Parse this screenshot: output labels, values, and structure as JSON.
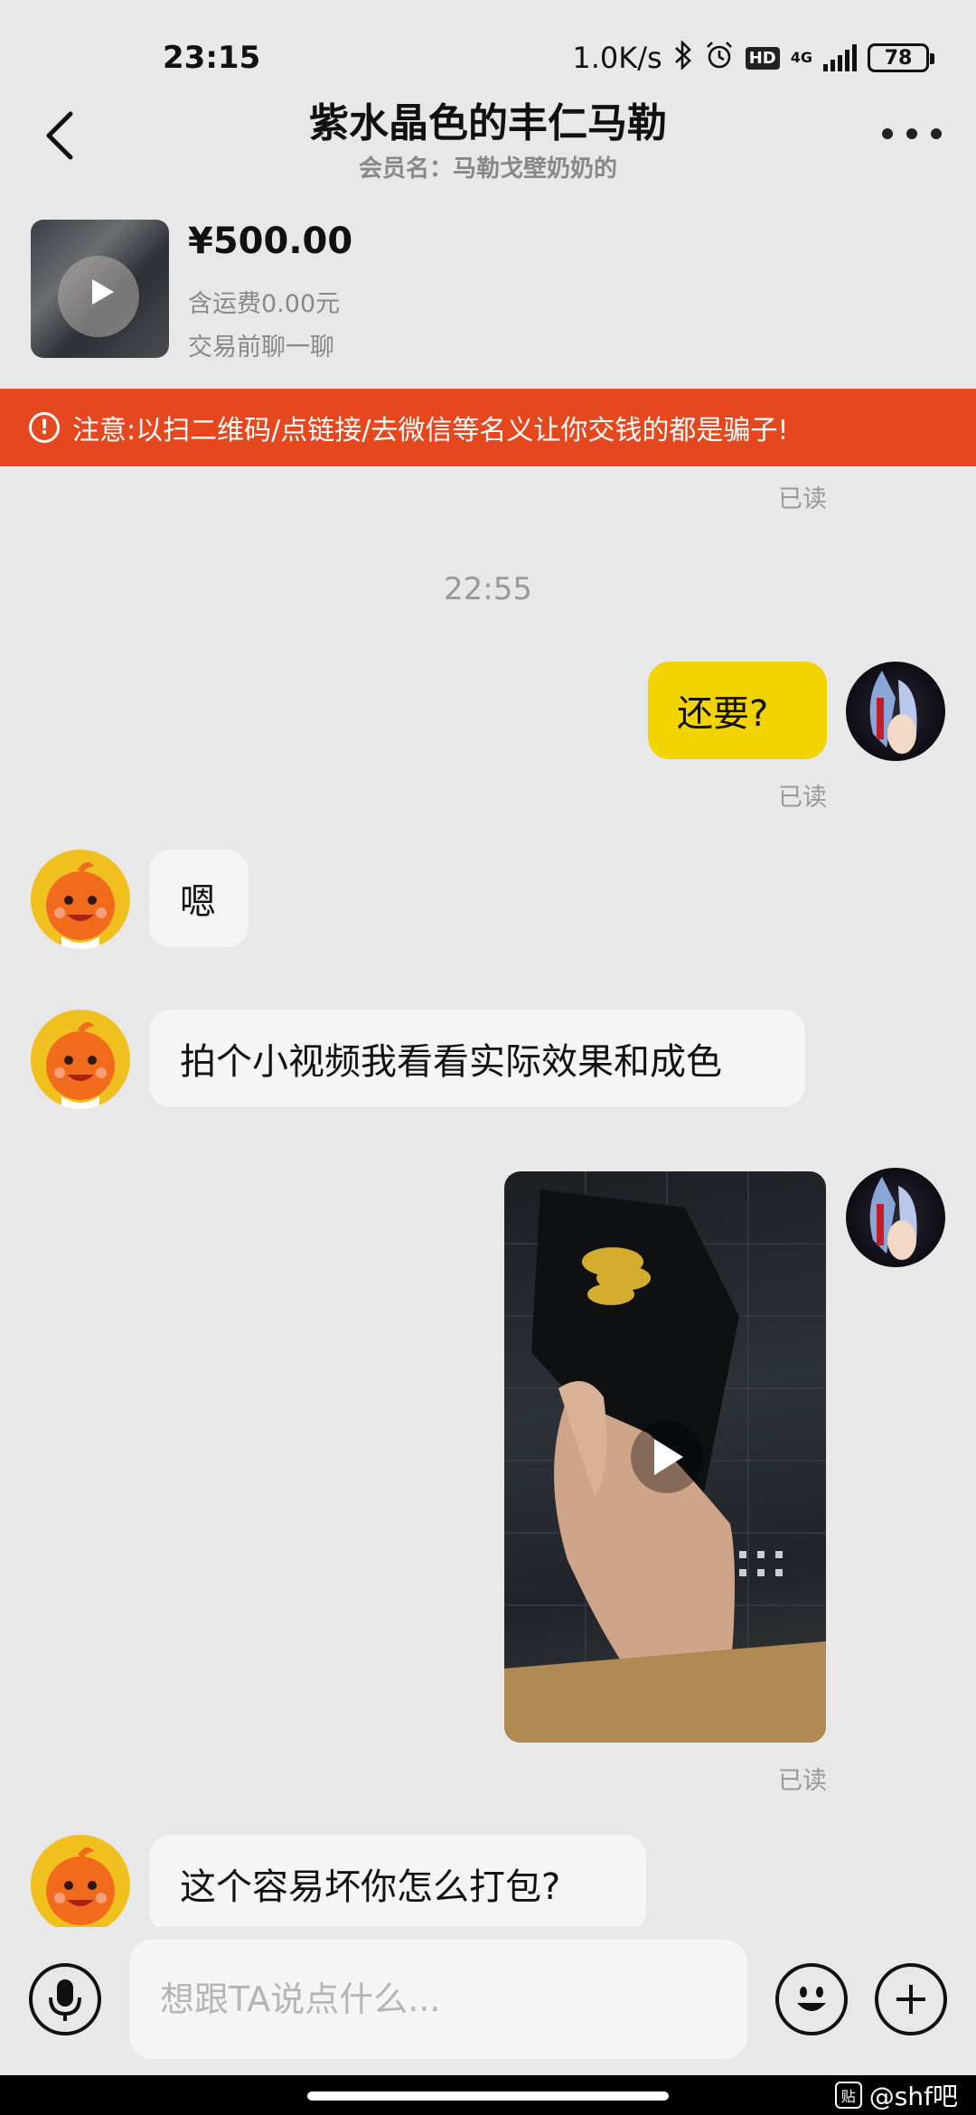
{
  "status_bar": {
    "time": "23:15",
    "net_speed": "1.0K/s",
    "hd": "HD",
    "network": "4G",
    "battery": "78"
  },
  "header": {
    "title": "紫水晶色的丰仁马勒",
    "subtitle": "会员名：马勒戈壁奶奶的"
  },
  "product": {
    "price": "¥500.00",
    "shipping": "含运费0.00元",
    "status": "交易前聊一聊"
  },
  "warning": {
    "text": "注意:以扫二维码/点链接/去微信等名义让你交钱的都是骗子!"
  },
  "chat": {
    "read_label": "已读",
    "time_separator": "22:55",
    "messages": [
      {
        "from": "me",
        "text": "还要?"
      },
      {
        "from": "them",
        "text": "嗯"
      },
      {
        "from": "them",
        "text": "拍个小视频我看看实际效果和成色"
      },
      {
        "from": "me",
        "type": "video"
      },
      {
        "from": "them",
        "text": "这个容易坏你怎么打包?"
      }
    ]
  },
  "input": {
    "placeholder": "想跟TA说点什么..."
  },
  "watermark": {
    "badge": "贴",
    "text": "@shf吧"
  },
  "colors": {
    "accent_yellow": "#f2d400",
    "warning_red": "#e5471e",
    "background": "#e8e8e8"
  }
}
